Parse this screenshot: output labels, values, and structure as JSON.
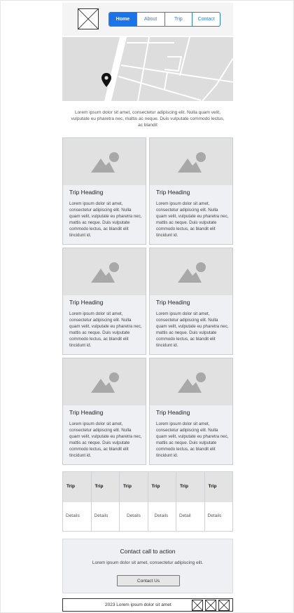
{
  "nav": {
    "items": [
      {
        "label": "Home"
      },
      {
        "label": "About"
      },
      {
        "label": "Trip"
      },
      {
        "label": "Contact"
      }
    ]
  },
  "map": {
    "marker_icon": "map-pin-icon"
  },
  "intro": {
    "text": "Lorem ipsum dolor sit amet, consectetur adipiscing elit. Nulla quam velit, vulputate eu pharetra nec, mattis ac neque. Duis vulputate commodo lectus, ac blandit"
  },
  "cards": [
    {
      "title": "Trip Heading",
      "text": "Lorem ipsum dolor sit amet, consectetur adipiscing elit. Nulla quam velit, vulputate eu pharetra nec, mattis ac neque. Duis vulputate commodo lectus, ac blandit elit tincidunt id."
    },
    {
      "title": "Trip Heading",
      "text": "Lorem ipsum dolor sit amet, consectetur adipiscing elit. Nulla quam velit, vulputate eu pharetra nec, mattis ac neque. Duis vulputate commodo lectus, ac blandit elit tincidunt id."
    },
    {
      "title": "Trip Heading",
      "text": "Lorem ipsum dolor sit amet, consectetur adipiscing elit. Nulla quam velit, vulputate eu pharetra nec, mattis ac neque. Duis vulputate commodo lectus, ac blandit elit tincidunt id."
    },
    {
      "title": "Trip Heading",
      "text": "Lorem ipsum dolor sit amet, consectetur adipiscing elit. Nulla quam velit, vulputate eu pharetra nec, mattis ac neque. Duis vulputate commodo lectus, ac blandit elit tincidunt id."
    },
    {
      "title": "Trip Heading",
      "text": "Lorem ipsum dolor sit amet, consectetur adipiscing elit. Nulla quam velit, vulputate eu pharetra nec, mattis ac neque. Duis vulputate commodo lectus, ac blandit elit tincidunt id."
    },
    {
      "title": "Trip Heading",
      "text": "Lorem ipsum dolor sit amet, consectetur adipiscing elit. Nulla quam velit, vulputate eu pharetra nec, mattis ac neque. Duis vulputate commodo lectus, ac blandit elit tincidunt id."
    }
  ],
  "table": {
    "headers": [
      "Trip",
      "Trip",
      "Trip",
      "Trip",
      "Trip",
      "Trip"
    ],
    "cells": [
      "Details",
      "Details",
      "Details",
      "Details",
      "Detail",
      "Details"
    ]
  },
  "cta": {
    "title": "Contact call to action",
    "text": "Lorem ipsum dolor sit amet, consectetur adipiscing elit.",
    "button_label": "Contact Us"
  },
  "footer": {
    "text": "2023 Lorem ipsum dolor sit amet",
    "icons": [
      "social-placeholder-icon",
      "social-placeholder-icon",
      "social-placeholder-icon"
    ]
  },
  "colors": {
    "accent": "#1a73e8",
    "card_bg": "#eff0f4",
    "image_placeholder": "#e1e1e1"
  }
}
